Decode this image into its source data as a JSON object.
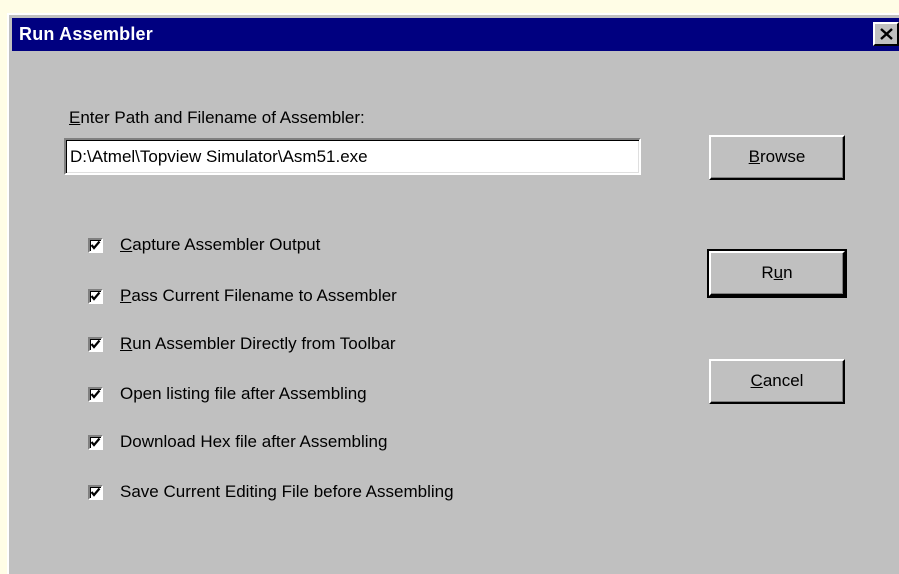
{
  "window": {
    "title": "Run Assembler",
    "close_icon": "close-icon"
  },
  "path": {
    "label_first": "E",
    "label_rest": "nter Path and Filename of Assembler:",
    "value": "D:\\Atmel\\Topview Simulator\\Asm51.exe"
  },
  "buttons": {
    "browse": {
      "first": "B",
      "rest": "rowse"
    },
    "run": {
      "pre": "R",
      "underline": "u",
      "post": "n"
    },
    "cancel": {
      "first": "C",
      "rest": "ancel"
    }
  },
  "options": [
    {
      "pre": "",
      "underline": "C",
      "post": "apture Assembler Output",
      "checked": true
    },
    {
      "pre": "",
      "underline": "P",
      "post": "ass Current Filename to Assembler",
      "checked": true
    },
    {
      "pre": "",
      "underline": "R",
      "post": "un Assembler Directly from Toolbar",
      "checked": true
    },
    {
      "pre": "Open listing file after Assembling",
      "underline": "",
      "post": "",
      "checked": true
    },
    {
      "pre": "Download Hex file after Assembling",
      "underline": "",
      "post": "",
      "checked": true
    },
    {
      "pre": "Save Current Editing File before Assembling",
      "underline": "",
      "post": "",
      "checked": true
    }
  ],
  "colors": {
    "titlebar": "#000080",
    "face": "#c0c0c0",
    "backdrop": "#fffde6"
  }
}
